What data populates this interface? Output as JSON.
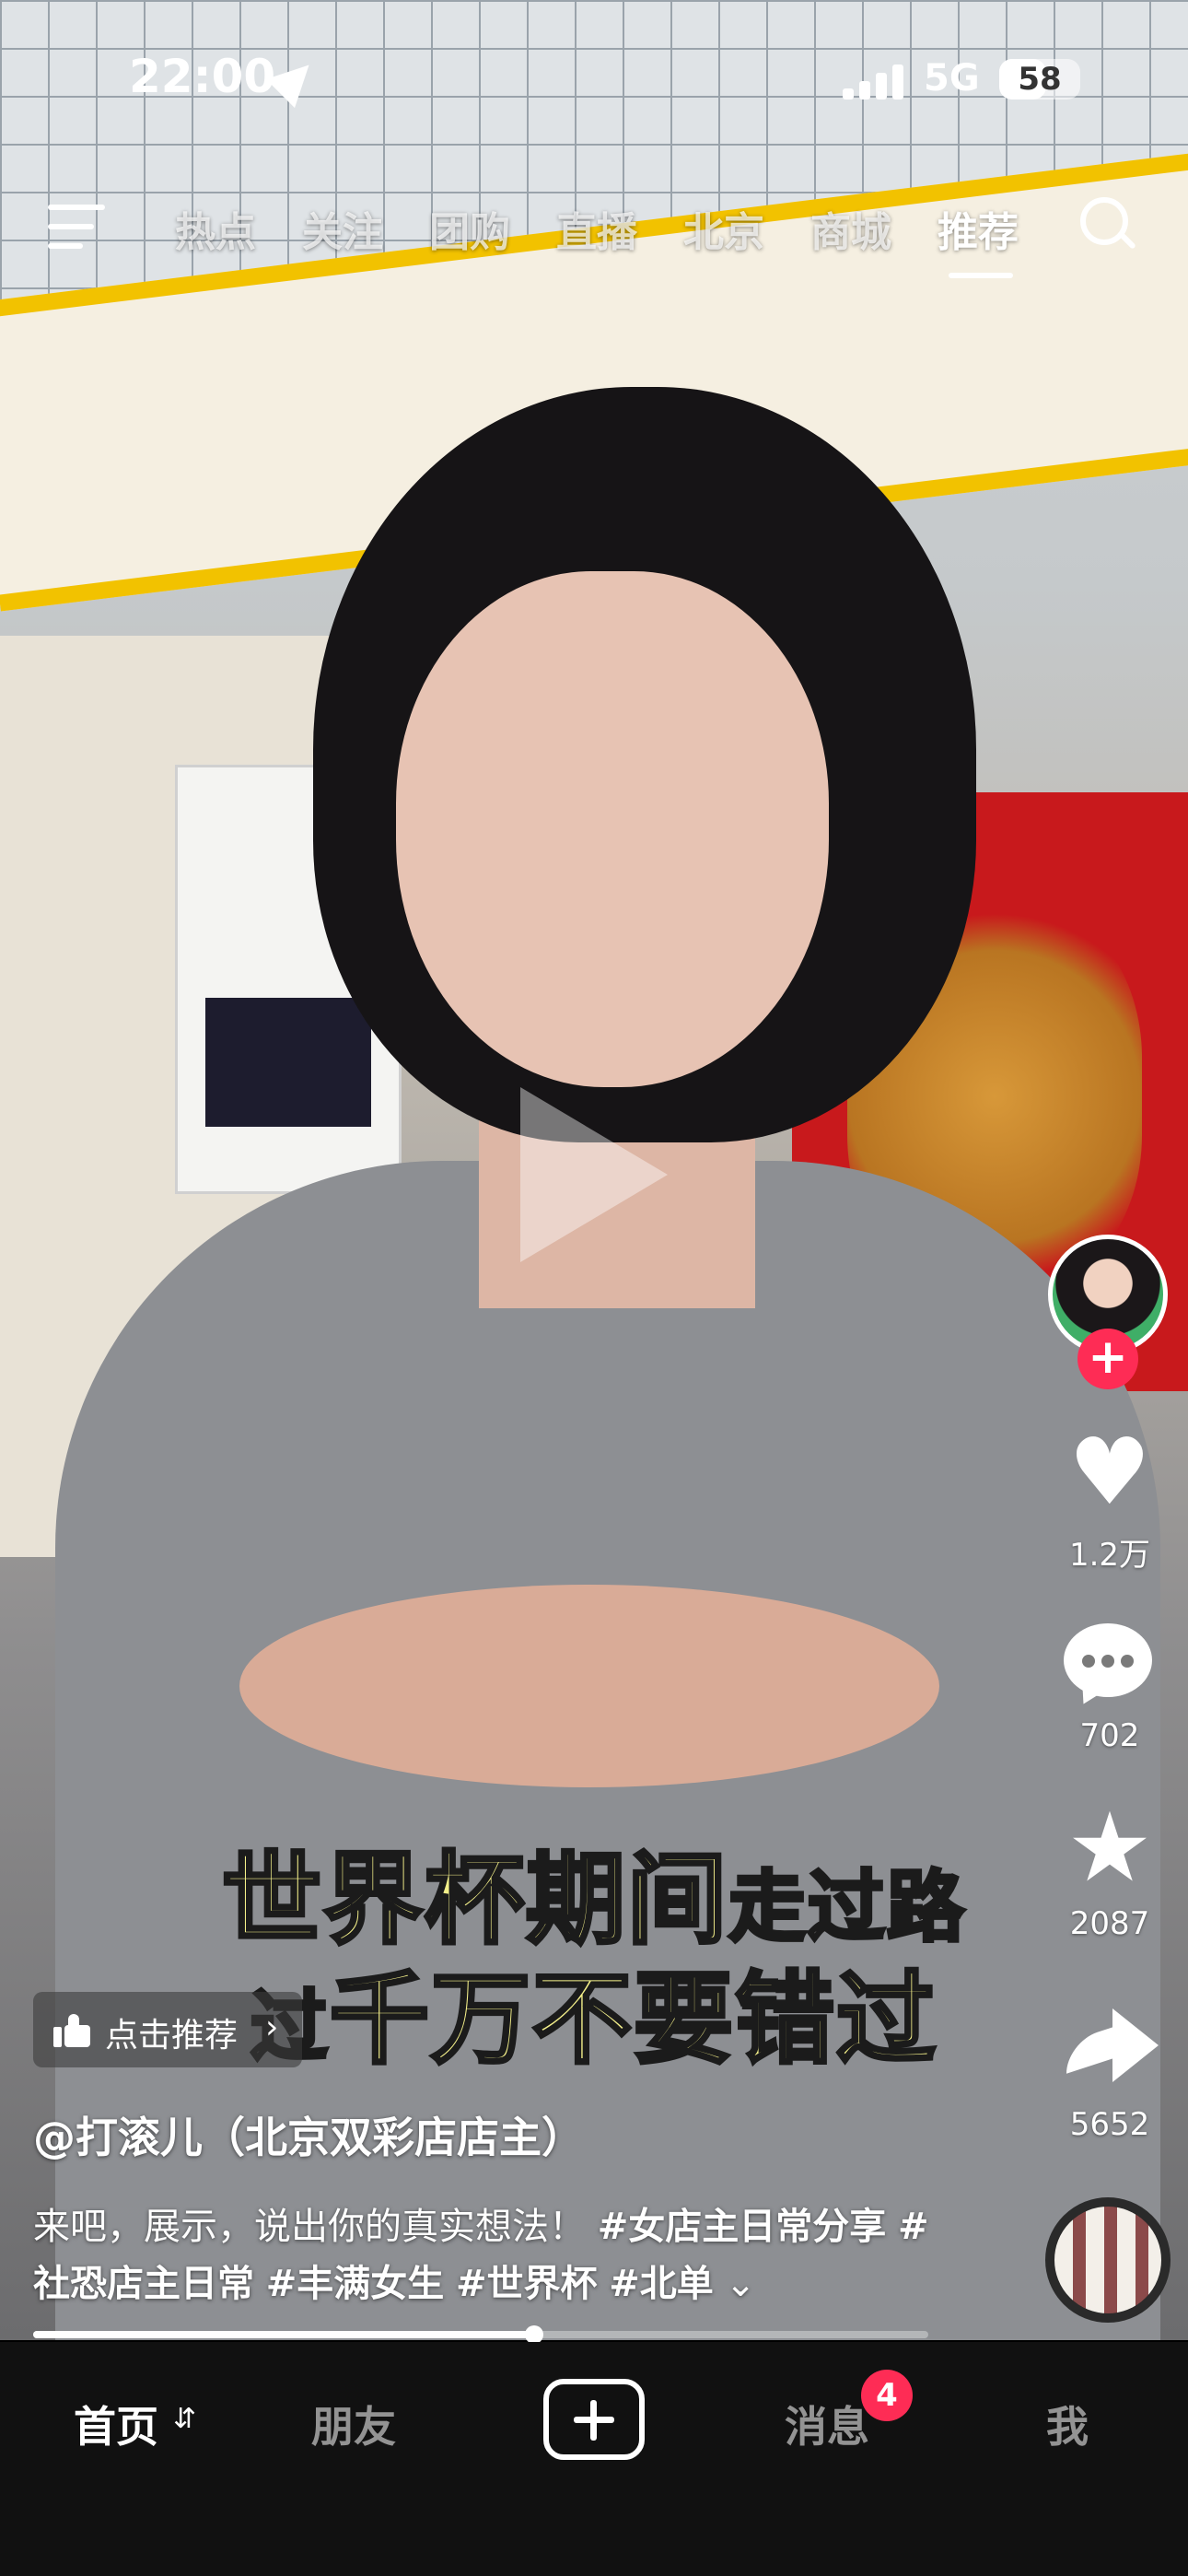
{
  "status_bar": {
    "time": "22:00",
    "network": "5G",
    "battery": "58",
    "battery_level": 0.58
  },
  "top_nav": {
    "tabs": [
      "热点",
      "关注",
      "团购",
      "直播",
      "北京",
      "商城",
      "推荐"
    ],
    "active_tab": "推荐"
  },
  "video": {
    "caption_line1_big": "世界杯期间",
    "caption_line1_small": "走过路",
    "caption_line2_small": "过",
    "caption_line2_big": "千万不要错过"
  },
  "actions": {
    "follow_symbol": "+",
    "likes": "1.2万",
    "comments": "702",
    "favorites": "2087",
    "shares": "5652"
  },
  "recommend_chip": {
    "label": "点击推荐",
    "chevron": "›"
  },
  "post": {
    "author": "@打滚儿（北京双彩店店主）",
    "description": "来吧，展示，说出你的真实想法！",
    "hashtags": [
      "#女店主日常分享",
      "#社恐店主日常",
      "#丰满女生",
      "#世界杯",
      "#北单"
    ],
    "expand_symbol": "⌄"
  },
  "progress": {
    "fraction": 0.56
  },
  "bottom_tabs": {
    "home": "首页",
    "home_switch": "⇵",
    "friends": "朋友",
    "create": "+",
    "messages": "消息",
    "messages_badge": "4",
    "me": "我"
  },
  "colors": {
    "accent": "#fe2c55",
    "caption_yellow": "#f4f08a",
    "tabbar_bg": "#111111"
  }
}
